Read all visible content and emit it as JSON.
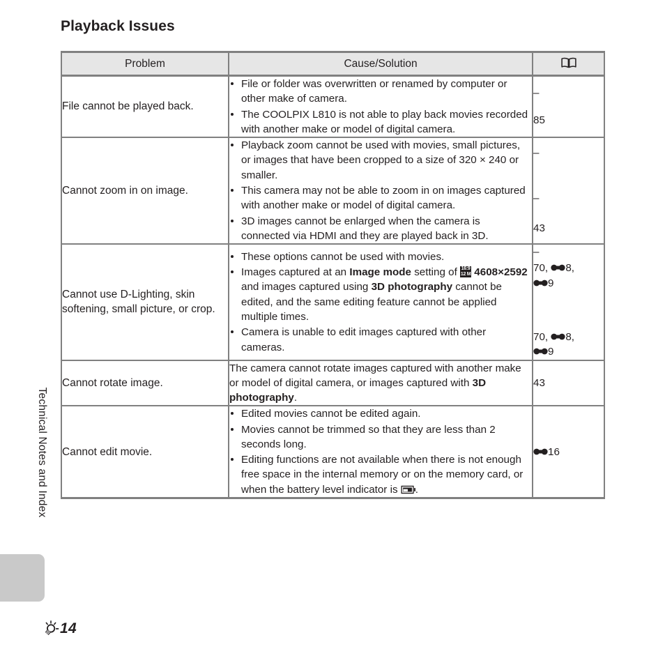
{
  "page": {
    "title": "Playback Issues",
    "side_tab_label": "Technical Notes and Index",
    "footer_page": "14",
    "footer_icon": "tip-bulb-icon"
  },
  "table": {
    "headers": {
      "problem": "Problem",
      "cause": "Cause/Solution",
      "reference_icon": "open-book-icon"
    },
    "rows": [
      {
        "problem": "File cannot be played back.",
        "bulleted": true,
        "causes": [
          "File or folder was overwritten or renamed by computer or other make of camera.",
          "The COOLPIX L810 is not able to play back movies recorded with another make or model of digital camera."
        ],
        "references": [
          "–",
          "85"
        ]
      },
      {
        "problem": "Cannot zoom in on image.",
        "bulleted": true,
        "causes": [
          "Playback zoom cannot be used with movies, small pictures, or images that have been cropped to a size of 320 × 240 or smaller.",
          "This camera may not be able to zoom in on images captured with another make or model of digital camera.",
          "3D images cannot be enlarged when the camera is connected via HDMI and they are played back in 3D."
        ],
        "references": [
          "–",
          "–",
          "43"
        ]
      },
      {
        "problem": "Cannot use D-Lighting, skin softening, small picture, or crop.",
        "bulleted": true,
        "causes": [
          "These options cannot be used with movies.",
          "Images captured at an Image mode setting of [16:9 12M] 4608×2592 and images captured using 3D photography cannot be edited, and the same editing feature cannot be applied multiple times.",
          "Camera is unable to edit images captured with other cameras."
        ],
        "references": [
          "–",
          "70, ●8, ●9",
          "70, ●8, ●9"
        ],
        "image_mode_badge": {
          "top": "16:9",
          "bottom": "12 M"
        },
        "bold_terms": [
          "Image mode",
          "4608×2592",
          "3D photography"
        ],
        "ref_groups": [
          {
            "lines": [
              "–"
            ]
          },
          {
            "lines": [
              "70, ",
              "8,",
              "9"
            ],
            "page_numbers": [
              "70",
              "8",
              "9"
            ]
          },
          {
            "lines": [
              "70, ",
              "8,",
              "9"
            ],
            "page_numbers": [
              "70",
              "8",
              "9"
            ]
          }
        ]
      },
      {
        "problem": "Cannot rotate image.",
        "bulleted": false,
        "causes": [
          "The camera cannot rotate images captured with another make or model of digital camera, or images captured with 3D photography."
        ],
        "references": [
          "43"
        ],
        "bold_terms": [
          "3D photography"
        ]
      },
      {
        "problem": "Cannot edit movie.",
        "bulleted": true,
        "causes": [
          "Edited movies cannot be edited again.",
          "Movies cannot be trimmed so that they are less than 2 seconds long.",
          "Editing functions are not available when there is not enough free space in the internal memory or on the memory card, or when the battery level indicator is [battery-low-icon]."
        ],
        "references": [
          "16"
        ],
        "reference_prefix_icon": "reference-section-icon"
      }
    ]
  },
  "row3_text": {
    "c1": "These options cannot be used with movies.",
    "c2_a": "Images captured at an ",
    "c2_b": "Image mode",
    "c2_c": " setting of ",
    "c2_d": "4608×2592",
    "c2_e": " and images captured using ",
    "c2_f": "3D",
    "c2_g": "photography",
    "c2_h": " cannot be edited, and the same editing feature cannot be applied multiple times.",
    "c3": "Camera is unable to edit images captured with other cameras."
  },
  "row4_text": {
    "a": "The camera cannot rotate images captured with another make or model of digital camera, or images captured with ",
    "b": "3D photography",
    "c": "."
  },
  "row5_text": {
    "c1": "Edited movies cannot be edited again.",
    "c2": "Movies cannot be trimmed so that they are less than 2 seconds long.",
    "c3_a": "Editing functions are not available when there is not enough free space in the internal memory or on the memory card, or when the battery level indicator is ",
    "c3_b": "."
  },
  "refs": {
    "dash": "–",
    "r1b": "85",
    "r2c": "43",
    "r3_70": "70, ",
    "r3_8": "8,",
    "r3_9": "9",
    "r4": "43",
    "r5": "16"
  }
}
